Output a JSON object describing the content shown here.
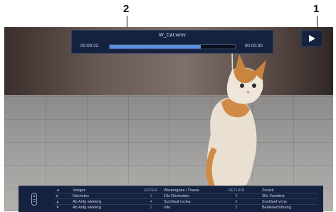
{
  "callouts": {
    "one": "1",
    "two": "2"
  },
  "player": {
    "filename": "W_Cat.wmv",
    "time_elapsed": "00:00:22",
    "time_total": "00:00:30",
    "progress_fraction": 0.73,
    "status_icon": "play-icon"
  },
  "help": {
    "rows": [
      {
        "arrow": "◄",
        "action1": "Voriges",
        "key2": "ENTER",
        "action2": "Wiedergabe / Pause",
        "key3": "RETURN",
        "action3": "Zurück"
      },
      {
        "arrow": "►",
        "action1": "Nächstes",
        "key2": "1",
        "action2": "10s Rückwärts",
        "key3": "3",
        "action3": "30s Vorwärts"
      },
      {
        "arrow": "▲",
        "action1": "Ab Anfg wiederg.",
        "key2": "4",
        "action2": "Suchlauf rückw.",
        "key3": "6",
        "action3": "Suchlauf vorw."
      },
      {
        "arrow": "▼",
        "action1": "Ab Anfg wiederg.",
        "key2": "2",
        "action2": "Info",
        "key3": "5",
        "action3": "Bedienerführung"
      }
    ]
  },
  "colors": {
    "panel": "#15223f",
    "accent": "#5a8fe0"
  }
}
